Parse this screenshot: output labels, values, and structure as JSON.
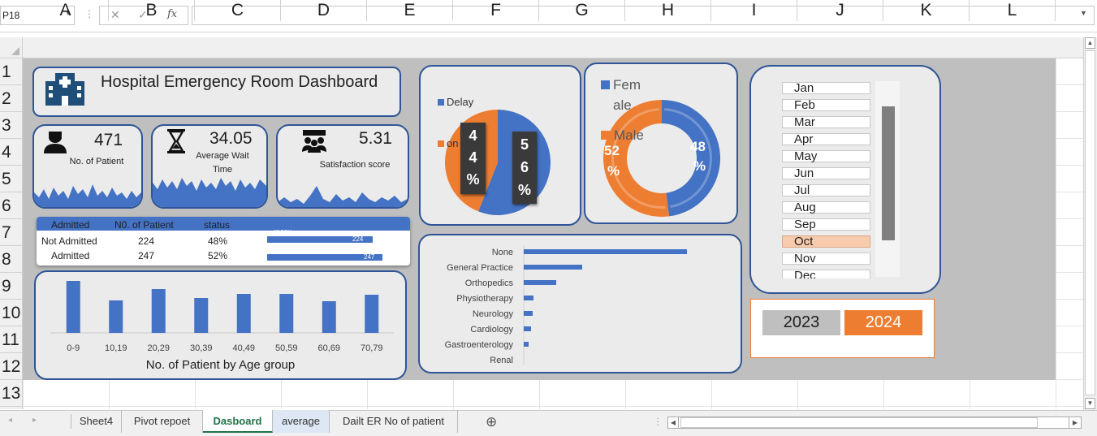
{
  "formula_bar": {
    "name_box": "P18",
    "cancel_icon": "✕",
    "enter_icon": "✓",
    "fx_icon": "fx",
    "formula": ""
  },
  "columns": [
    "A",
    "B",
    "C",
    "D",
    "E",
    "F",
    "G",
    "H",
    "I",
    "J",
    "K",
    "L"
  ],
  "rows": [
    "1",
    "2",
    "3",
    "4",
    "5",
    "6",
    "7",
    "8",
    "9",
    "10",
    "11",
    "12",
    "13"
  ],
  "dashboard": {
    "title": "Hospital Emergency Room Dashboard",
    "kpis": [
      {
        "value": "471",
        "label": "No. of Patient",
        "icon": "patient-icon"
      },
      {
        "value": "34.05",
        "label_line1": "Average Wait",
        "label_line2": "Time",
        "icon": "hourglass-icon"
      },
      {
        "value": "5.31",
        "label": "Satisfaction score",
        "icon": "group-icon"
      }
    ],
    "status_table": {
      "headers": [
        "Admitted",
        "N0. of Patient",
        "status"
      ],
      "rows": [
        {
          "label": "Not Admitted",
          "count": "224",
          "pct": "48%",
          "bar_label": "47.56%",
          "bar_value": "224"
        },
        {
          "label": "Admitted",
          "count": "247",
          "pct": "52%",
          "bar_label": "52.44%",
          "bar_value": "247"
        }
      ]
    },
    "delay_pie": {
      "legend": [
        {
          "label": "Delay",
          "color": "#4472c4"
        },
        {
          "label": "on",
          "color": "#ed7d31"
        }
      ],
      "orange_label": [
        "4",
        "4",
        "%"
      ],
      "blue_label": [
        "5",
        "6",
        "%"
      ]
    },
    "gender_donut": {
      "legend": [
        {
          "label_line1": "Fem",
          "label_line2": "ale",
          "color": "#4472c4"
        },
        {
          "label": "Male",
          "color": "#ed7d31"
        }
      ],
      "orange_label": [
        "52",
        "%"
      ],
      "blue_label": [
        "48",
        "%"
      ]
    },
    "months": [
      "Jan",
      "Feb",
      "Mar",
      "Apr",
      "May",
      "Jun",
      "Jul",
      "Aug",
      "Sep",
      "Oct",
      "Nov",
      "Dec"
    ],
    "selected_month": "Oct",
    "years": [
      "2023",
      "2024"
    ],
    "selected_year": "2024"
  },
  "chart_data": [
    {
      "type": "bar",
      "title": "No. of Patient by Age group",
      "categories": [
        "0-9",
        "10,19",
        "20,29",
        "30,39",
        "40,49",
        "50,59",
        "60,69",
        "70,79"
      ],
      "values": [
        64,
        40,
        54,
        43,
        48,
        48,
        39,
        47
      ],
      "ylim": [
        0,
        70
      ],
      "orientation": "vertical",
      "color": "#4472c4"
    },
    {
      "type": "bar",
      "orientation": "horizontal",
      "categories": [
        "None",
        "General Practice",
        "Orthopedics",
        "Physiotherapy",
        "Neurology",
        "Cardiology",
        "Gastroenterology",
        "Renal"
      ],
      "values": [
        201,
        72,
        40,
        12,
        11,
        9,
        6,
        0
      ],
      "xlim": [
        0,
        210
      ],
      "color": "#4472c4"
    },
    {
      "type": "pie",
      "labels": [
        "Delay",
        "on"
      ],
      "values": [
        56,
        44
      ],
      "colors": [
        "#4472c4",
        "#ed7d31"
      ]
    },
    {
      "type": "pie",
      "variant": "donut",
      "labels": [
        "Female",
        "Male"
      ],
      "values": [
        48,
        52
      ],
      "colors": [
        "#4472c4",
        "#ed7d31"
      ]
    }
  ],
  "sheet_tabs": [
    "Sheet4",
    "Pivot repoet",
    "Dasboard",
    "average",
    "Dailt ER No of patient"
  ],
  "active_tab": "Dasboard",
  "add_sheet_icon": "⊕"
}
